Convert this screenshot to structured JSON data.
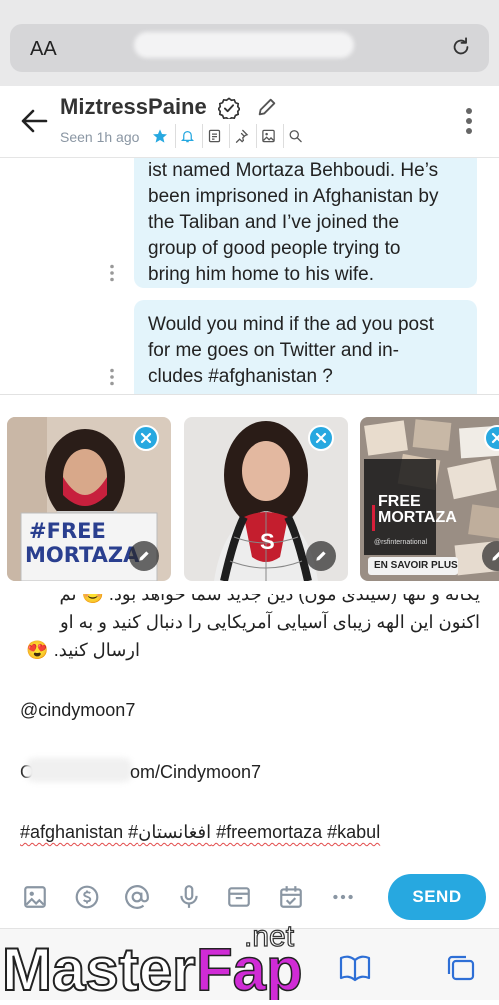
{
  "browser": {
    "text_size_label": "AA",
    "reload_icon": "reload-icon"
  },
  "header": {
    "username": "MiztressPaine",
    "last_seen": "Seen 1h ago"
  },
  "messages": [
    {
      "lines": [
        "ist named Mortaza Behboudi. He’s",
        "been imprisoned in Afghanistan by",
        "the Taliban and I’ve joined the",
        "group of good people trying to",
        "bring him home to his wife."
      ]
    },
    {
      "lines": [
        "Would you mind if the ad you post",
        "for me goes on Twitter and in-",
        "cludes #afghanistan ?"
      ]
    }
  ],
  "attachments": [
    {
      "sign_line1": "#FREE",
      "sign_line2": "MORTAZA"
    },
    {
      "caption": ""
    },
    {
      "badge_line1": "FREE",
      "badge_line2": "MORTAZA",
      "handle": "@rsfinternational",
      "cta": "EN SAVOIR PLUS"
    }
  ],
  "compose": {
    "line1": "یکانه و تنها (سیندی مون) دین جدید شما خواهد بود. 😊 ثم",
    "line2": "اکنون این الهه زیبای آسیایی آمریکایی را دنبال کنید و به او",
    "line3": "ارسال کنید. 😍",
    "mention": "@cindymoon7",
    "link_tail": "om/Cindymoon7",
    "link_head": "O",
    "hashtags": "#afghanistan #افغانستان #freemortaza #kabul"
  },
  "toolbar": {
    "send_label": "SEND"
  },
  "watermark": {
    "text_white": "Master",
    "text_pink": "Fap",
    "suffix": ".net"
  },
  "colors": {
    "accent": "#27a8e0",
    "bubble": "#e3f4fb",
    "muted": "#8a96a3"
  }
}
